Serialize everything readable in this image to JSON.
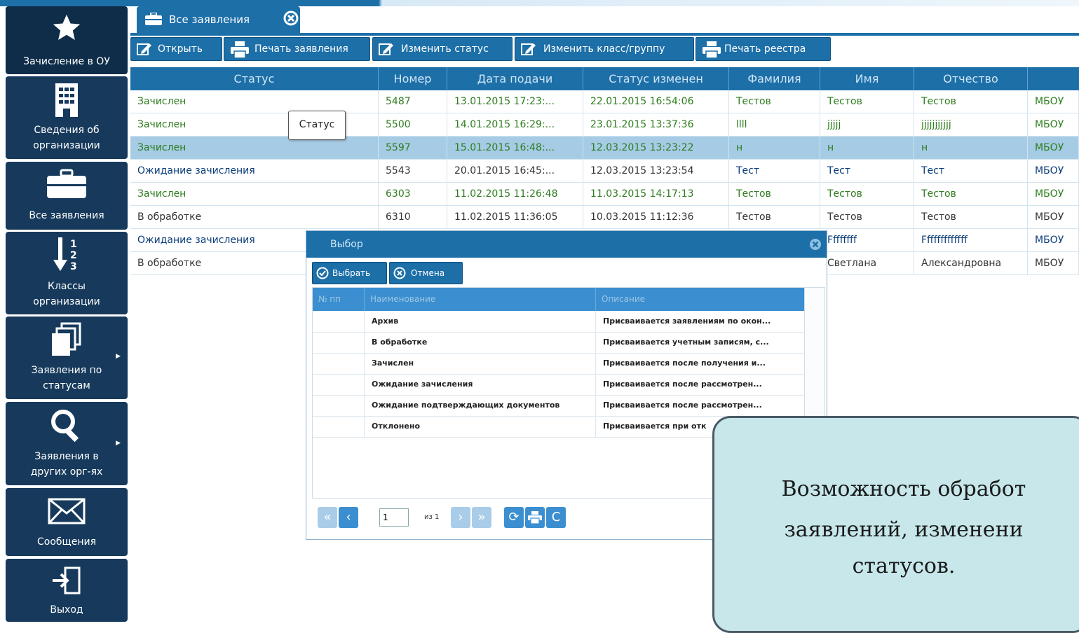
{
  "sidebar": {
    "items": [
      {
        "label": "Зачисление в ОУ",
        "icon": "star-icon"
      },
      {
        "label1": "Сведения об",
        "label2": "организации",
        "icon": "building-icon"
      },
      {
        "label": "Все заявления",
        "icon": "briefcase-icon"
      },
      {
        "label1": "Классы",
        "label2": "организации",
        "icon": "sort-icon"
      },
      {
        "label1": "Заявления по",
        "label2": "статусам",
        "icon": "stack-icon"
      },
      {
        "label1": "Заявления в",
        "label2": "других орг-ях",
        "icon": "search-icon"
      },
      {
        "label": "Сообщения",
        "icon": "envelope-icon"
      },
      {
        "label": "Выход",
        "icon": "exit-icon"
      }
    ]
  },
  "tabs": [
    {
      "label": "Все заявления"
    }
  ],
  "toolbar": {
    "open": "Открыть",
    "print_application": "Печать заявления",
    "change_status": "Изменить статус",
    "change_class": "Изменить класс/группу",
    "print_register": "Печать реестра"
  },
  "grid": {
    "columns": [
      "Статус",
      "Номер",
      "Дата подачи",
      "Статус изменен",
      "Фамилия",
      "Имя",
      "Отчество",
      ""
    ],
    "rows": [
      {
        "status": "Зачислен",
        "number": "5487",
        "date": "13.01.2015 17:23:...",
        "changed": "22.01.2015 16:54:06",
        "last": "Тестов",
        "first": "Тестов",
        "middle": "Тестов",
        "org": "МБОУ"
      },
      {
        "status": "Зачислен",
        "number": "5500",
        "date": "14.01.2015 16:29:...",
        "changed": "23.01.2015 13:37:36",
        "last": "llll",
        "first": "jjjjj",
        "middle": "jjjjjjjjjjj",
        "org": "МБОУ"
      },
      {
        "status": "Зачислен",
        "number": "5597",
        "date": "15.01.2015 16:48:...",
        "changed": "12.03.2015 13:23:22",
        "last": "н",
        "first": "н",
        "middle": "н",
        "org": "МБОУ"
      },
      {
        "status": "Ожидание зачисления",
        "number": "5543",
        "date": "20.01.2015 16:45:...",
        "changed": "12.03.2015 13:23:54",
        "last": "Тест",
        "first": "Тест",
        "middle": "Тест",
        "org": "МБОУ"
      },
      {
        "status": "Зачислен",
        "number": "6303",
        "date": "11.02.2015 11:26:48",
        "changed": "11.03.2015 14:17:13",
        "last": "Тестов",
        "first": "Тестов",
        "middle": "Тестов",
        "org": "МБОУ"
      },
      {
        "status": "В обработке",
        "number": "6310",
        "date": "11.02.2015 11:36:05",
        "changed": "10.03.2015 11:12:36",
        "last": "Тестов",
        "first": "Тестов",
        "middle": "Тестов",
        "org": "МБОУ"
      },
      {
        "status": "Ожидание зачисления",
        "first": "Ffffffff",
        "middle": "Fffffffffffff",
        "org": "МБОУ"
      },
      {
        "status": "В обработке",
        "first": "Светлана",
        "middle": "Александровна",
        "org": "МБОУ"
      }
    ],
    "tooltip": "Статус"
  },
  "dialog": {
    "title": "Выбор",
    "select_button": "Выбрать",
    "cancel_button": "Отмена",
    "columns": [
      "№ пп",
      "Наименование",
      "Описание"
    ],
    "rows": [
      {
        "name": "Архив",
        "desc": "Присваивается заявлениям по окон..."
      },
      {
        "name": "В обработке",
        "desc": "Присваивается учетным записям, с..."
      },
      {
        "name": "Зачислен",
        "desc": "Присваивается после получения и..."
      },
      {
        "name": "Ожидание зачисления",
        "desc": "Присваивается после рассмотрен..."
      },
      {
        "name": "Ожидание подтверждающих документов",
        "desc": "Присваивается после рассмотрен..."
      },
      {
        "name": "Отклонено",
        "desc": "Присваивается при отк"
      }
    ],
    "pager": {
      "page": "1",
      "of": "из 1"
    }
  },
  "callout": {
    "line1": "Возможность обработ",
    "line2": "заявлений, изменени",
    "line3": "статусов."
  },
  "colors": {
    "accent": "#1d6fa8",
    "sidebar": "#173a5c",
    "status_green": "#2e7d1e",
    "callout_bg": "#c7e7ea"
  }
}
